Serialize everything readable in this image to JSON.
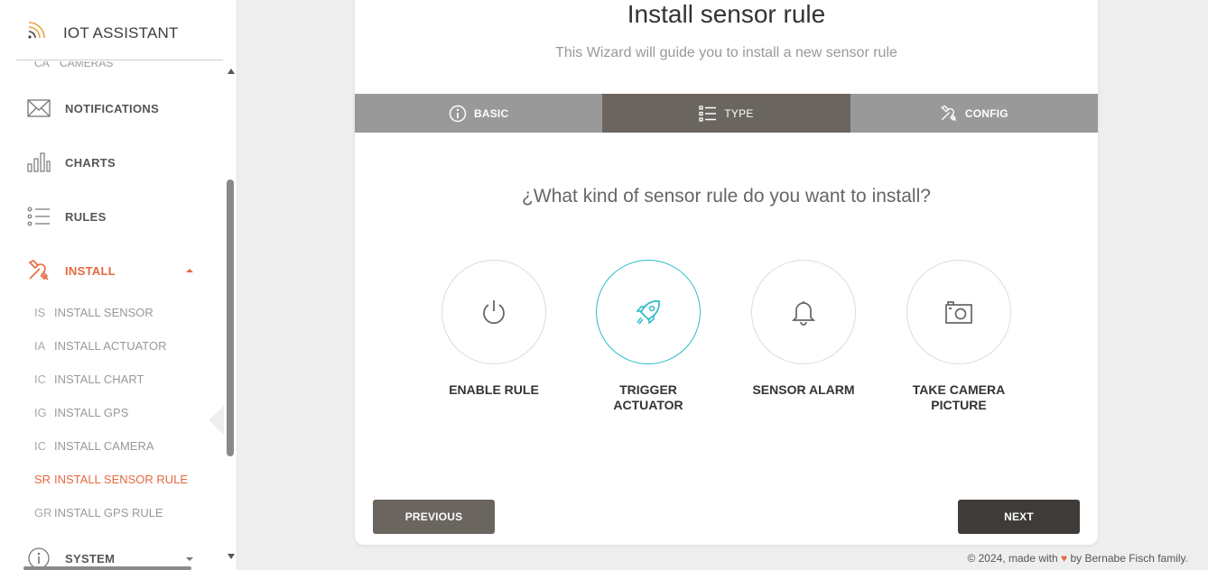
{
  "sidebar": {
    "brand_title": "IOT ASSISTANT",
    "cut_item": {
      "abbr": "CA",
      "label": "CAMERAS"
    },
    "nav": [
      {
        "label": "NOTIFICATIONS",
        "icon": "envelope-icon"
      },
      {
        "label": "CHARTS",
        "icon": "bar-chart-icon"
      },
      {
        "label": "RULES",
        "icon": "list-icon"
      },
      {
        "label": "INSTALL",
        "icon": "tools-icon",
        "active": true
      },
      {
        "label": "SYSTEM",
        "icon": "info-icon"
      }
    ],
    "install_sub": [
      {
        "abbr": "IS",
        "label": "INSTALL SENSOR"
      },
      {
        "abbr": "IA",
        "label": "INSTALL ACTUATOR"
      },
      {
        "abbr": "IC",
        "label": "INSTALL CHART"
      },
      {
        "abbr": "IG",
        "label": "INSTALL GPS"
      },
      {
        "abbr": "IC",
        "label": "INSTALL CAMERA"
      },
      {
        "abbr": "SR",
        "label": "INSTALL SENSOR RULE",
        "active": true
      },
      {
        "abbr": "GR",
        "label": "INSTALL GPS RULE"
      }
    ]
  },
  "wizard": {
    "title": "Install sensor rule",
    "subtitle": "This Wizard will guide you to install a new sensor rule",
    "tabs": [
      {
        "label": "BASIC",
        "icon": "info-circle-icon"
      },
      {
        "label": "TYPE",
        "icon": "list-icon",
        "active": true
      },
      {
        "label": "CONFIG",
        "icon": "tools-icon"
      }
    ],
    "question": "¿What kind of sensor rule do you want to install?",
    "choices": [
      {
        "label_line1": "ENABLE RULE",
        "label_line2": "",
        "icon": "power-icon"
      },
      {
        "label_line1": "TRIGGER",
        "label_line2": "ACTUATOR",
        "icon": "rocket-icon",
        "selected": true
      },
      {
        "label_line1": "SENSOR ALARM",
        "label_line2": "",
        "icon": "bell-icon"
      },
      {
        "label_line1": "TAKE CAMERA",
        "label_line2": "PICTURE",
        "icon": "camera-icon"
      }
    ],
    "previous_label": "PREVIOUS",
    "next_label": "NEXT"
  },
  "footer": {
    "prefix": "© 2024, made with",
    "heart": "♥",
    "suffix": "by Bernabe Fisch family."
  },
  "colors": {
    "accent": "#e5693f",
    "selected_ring": "#2bbbc9",
    "tab_bar": "#999999",
    "tab_active": "#6b6560",
    "next_button": "#3e3b38"
  }
}
